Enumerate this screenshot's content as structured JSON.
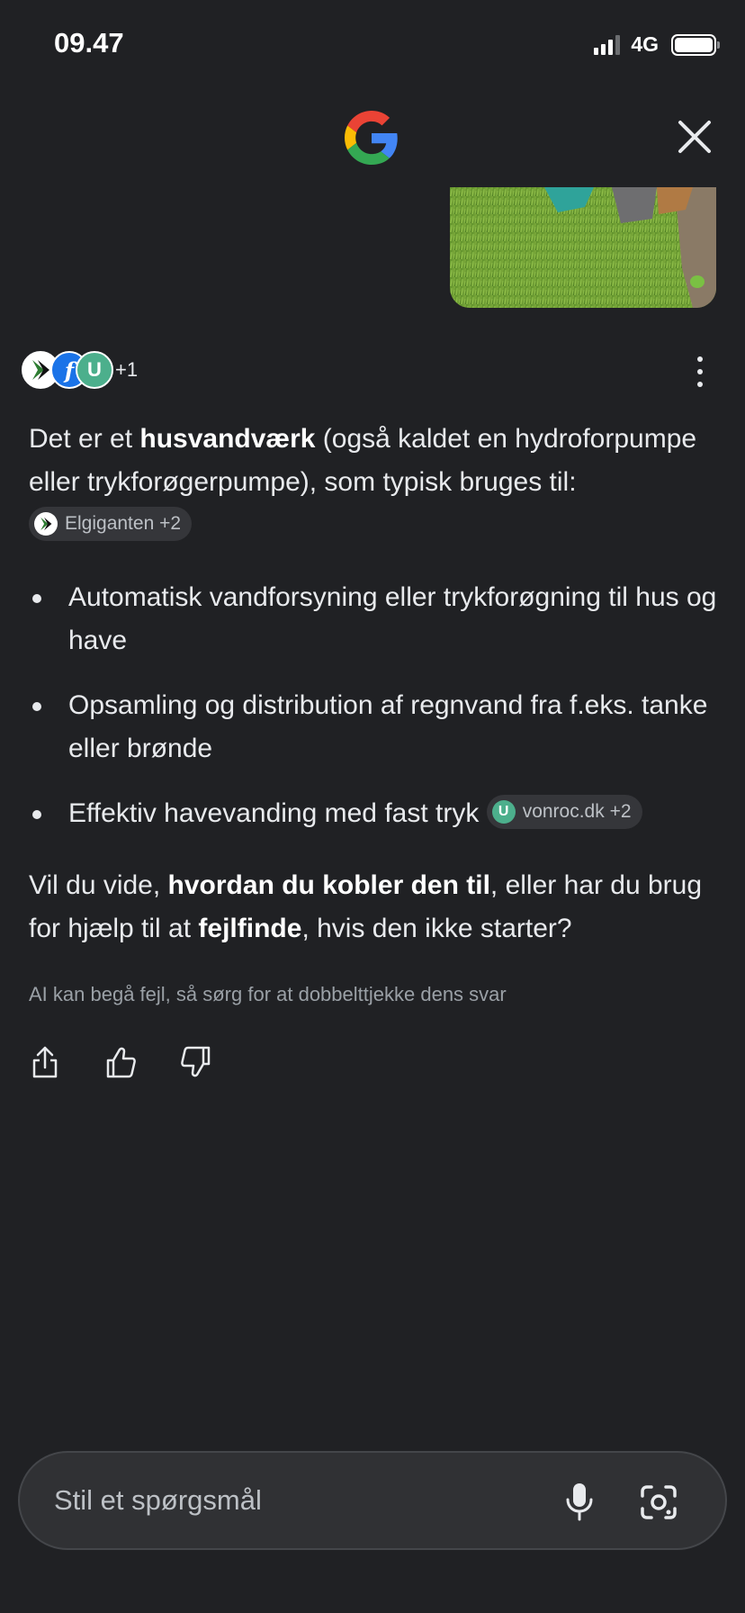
{
  "status_bar": {
    "time": "09.47",
    "network": "4G"
  },
  "header": {
    "logo_icon": "google-g-icon",
    "close_icon": "close-icon"
  },
  "sources": {
    "more": "+1",
    "icons": [
      "elgiganten-icon",
      "facebook-icon",
      "vonroc-icon"
    ]
  },
  "answer": {
    "p1_prefix": "Det er et ",
    "p1_bold": "husvandværk",
    "p1_suffix": " (også kaldet en hydroforpumpe eller trykforøgerpumpe), som typisk bruges til:",
    "chip1_label": "Elgiganten +2",
    "bullets": [
      "Automatisk vandforsyning eller trykforøgning til hus og have",
      "Opsamling og distribution af regnvand fra f.eks. tanke eller brønde",
      "Effektiv havevanding med fast tryk"
    ],
    "chip2_label": "vonroc.dk +2",
    "chip2_icon_letter": "U",
    "followup_a": "Vil du vide, ",
    "followup_b1": "hvordan du kobler den til",
    "followup_c": ", eller har du brug for hjælp til at ",
    "followup_b2": "fejlfinde",
    "followup_d": ", hvis den ikke starter?"
  },
  "disclaimer": "AI kan begå fejl, så sørg for at dobbelttjekke dens svar",
  "input": {
    "placeholder": "Stil et spørgsmål"
  },
  "colors": {
    "background": "#202124",
    "chip_bg": "#35363a",
    "input_bg": "#303134",
    "text": "#e8eaed",
    "muted": "#9aa0a6"
  }
}
